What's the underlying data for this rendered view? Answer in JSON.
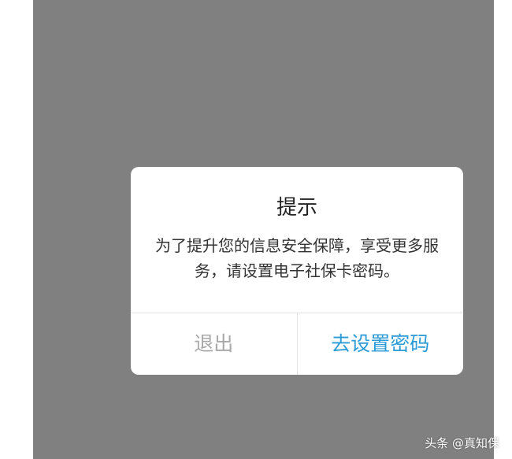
{
  "dialog": {
    "title": "提示",
    "message": "为了提升您的信息安全保障，享受更多服务，请设置电子社保卡密码。",
    "cancel_label": "退出",
    "confirm_label": "去设置密码"
  },
  "watermark": {
    "text": "头条 @真知保"
  },
  "colors": {
    "overlay": "#808080",
    "dialog_bg": "#ffffff",
    "confirm_text": "#2a9bd6",
    "cancel_text": "#a8a8a8"
  }
}
